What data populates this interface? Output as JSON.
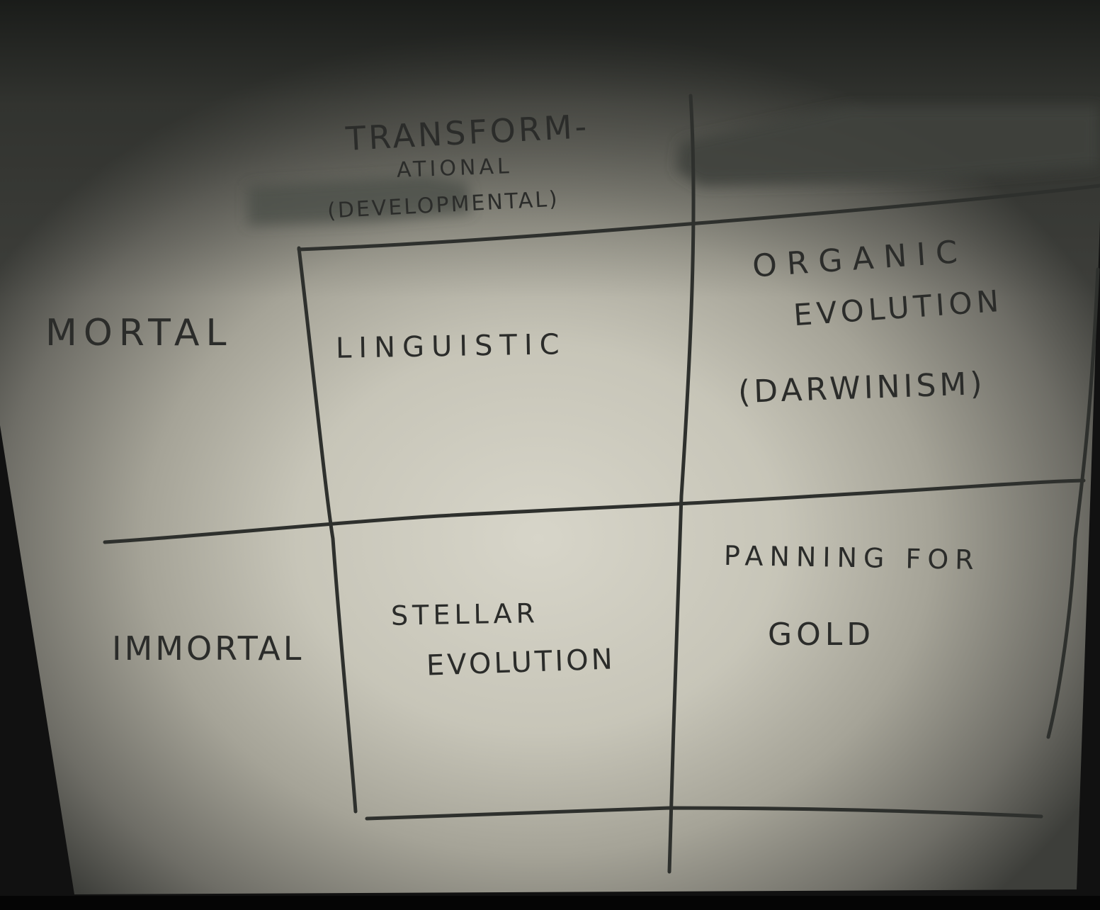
{
  "header": {
    "col1_line1": "TRANSFORM-",
    "col1_line2": "ATIONAL",
    "col1_line3": "(DEVELOPMENTAL)"
  },
  "rows": {
    "row1": "MORTAL",
    "row2": "IMMORTAL"
  },
  "cells": {
    "r1c1": "LINGUISTIC",
    "r1c2_line1": "ORGANIC",
    "r1c2_line2": "EVOLUTION",
    "r1c2_line3": "(DARWINISM)",
    "r2c1_line1": "STELLAR",
    "r2c1_line2": "EVOLUTION",
    "r2c2_line1": "PANNING FOR",
    "r2c2_line2": "GOLD"
  },
  "colors": {
    "ink": "#2b2c2a",
    "marker_smudge": "#4a4d47",
    "paper": "#cfcdc1"
  }
}
